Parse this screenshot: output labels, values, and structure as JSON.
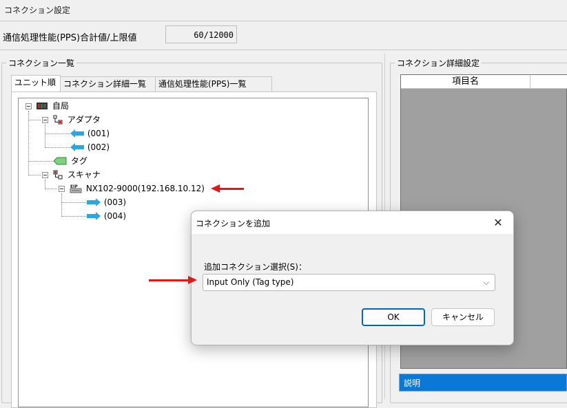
{
  "window": {
    "title": "コネクション設定"
  },
  "pps": {
    "label": "通信処理性能(PPS)合計値/上限値",
    "value": "60/12000"
  },
  "connection_list": {
    "title": "コネクション一覧",
    "tabs": [
      {
        "label": "ユニット順",
        "active": true
      },
      {
        "label": "コネクション詳細一覧",
        "active": false
      },
      {
        "label": "通信処理性能(PPS)一覧",
        "active": false
      }
    ],
    "tree": {
      "root": "自局",
      "adapter": "アダプタ",
      "adapter_children": [
        "(001)",
        "(002)"
      ],
      "tag": "タグ",
      "scanner": "スキャナ",
      "device": "NX102-9000(192.168.10.12)",
      "device_children": [
        "(003)",
        "(004)"
      ],
      "adapter_icon_text": "1!",
      "scanner_icon_text": "3!",
      "device_icon_text": "EIP"
    }
  },
  "detail": {
    "title": "コネクション詳細設定",
    "column_name": "項目名",
    "description": "説明"
  },
  "dialog": {
    "title": "コネクションを追加",
    "close_glyph": "✕",
    "field_label": "追加コネクション選択(S)：",
    "selected_option": "Input Only (Tag type)",
    "chevron": "⌵",
    "ok_label": "OK",
    "cancel_label": "キャンセル"
  },
  "colors": {
    "accent": "#0067c0",
    "selection": "#0a78d7",
    "annotation_arrow": "#e3161b"
  }
}
